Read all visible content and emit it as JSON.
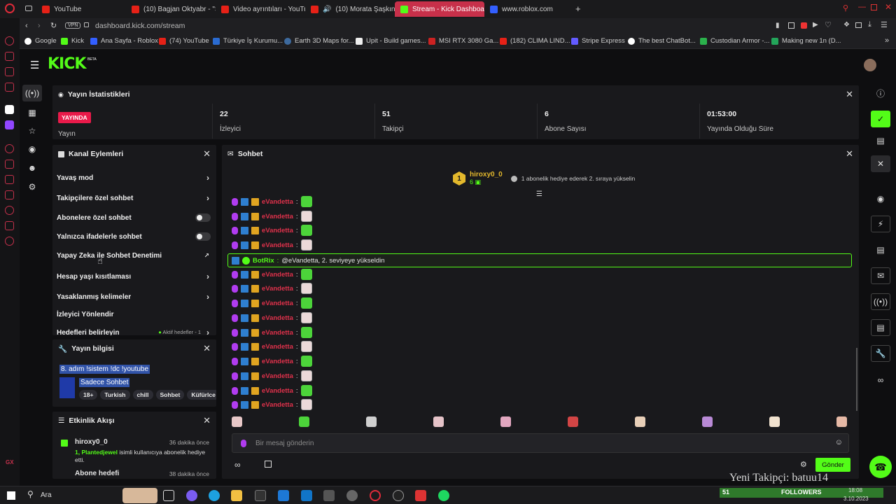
{
  "browser": {
    "tabs": [
      {
        "label": "YouTube",
        "color": "#e62117"
      },
      {
        "label": "(10) Bagjan Oktyabr - \"So",
        "color": "#e62117"
      },
      {
        "label": "Video ayrıntıları - YouTub",
        "color": "#e62117"
      },
      {
        "label": "(10) Morata Şaşkın #g",
        "color": "#e62117"
      },
      {
        "label": "Stream - Kick Dashboard",
        "color": "#53fc18"
      },
      {
        "label": "www.roblox.com",
        "color": "#335fff"
      }
    ],
    "address": "dashboard.kick.com/stream",
    "vpn_label": "VPN",
    "bookmarks": [
      "Google",
      "Kick",
      "Ana Sayfa - Roblox",
      "(74) YouTube",
      "Türkiye İş Kurumu...",
      "Earth 3D Maps for...",
      "Upit - Build games...",
      "MSI RTX 3080 Ga...",
      "(182) CLIMA LIND...",
      "Stripe Express",
      "The best ChatBot...",
      "Custodian Armor -...",
      "Making new 1n (D..."
    ]
  },
  "kick": {
    "logo": "KICK",
    "logo_sup": "BETA"
  },
  "stats": {
    "title": "Yayın İstatistikleri",
    "live_badge": "YAYINDA",
    "live_label": "Yayın",
    "items": [
      {
        "value": "22",
        "label": "İzleyici"
      },
      {
        "value": "51",
        "label": "Takipçi"
      },
      {
        "value": "6",
        "label": "Abone Sayısı"
      },
      {
        "value": "01:53:00",
        "label": "Yayında Olduğu Süre"
      }
    ]
  },
  "actions": {
    "title": "Kanal Eylemleri",
    "items": [
      "Yavaş mod",
      "Takipçilere özel sohbet",
      "Abonelere özel sohbet",
      "Yalnızca ifadelerle sohbet",
      "Yapay Zeka ile Sohbet Denetimi",
      "Hesap yaşı kısıtlaması",
      "Yasaklanmış kelimeler",
      "İzleyici Yönlendir",
      "Hedefleri belirleyin"
    ],
    "goals_hint": "Aktif hedefler - 1"
  },
  "streaminfo": {
    "title": "Yayın bilgisi",
    "stream_title": "8. adım !sistem !dc !youtube",
    "category": "Sadece Sohbet",
    "tags": [
      "18+",
      "Turkish",
      "chill",
      "Sohbet",
      "Küfürlce"
    ]
  },
  "activity": {
    "title": "Etkinlik Akışı",
    "items": [
      {
        "user": "hiroxy0_0",
        "time": "36 dakika önce",
        "desc_highlight": "1, Plantedjewel",
        "desc": " isimli kullanıcıya abonelik hediye etti."
      },
      {
        "user": "Abone hedefi",
        "time": "38 dakika önce"
      }
    ]
  },
  "chat": {
    "title": "Sohbet",
    "pinned_user": "hiroxy0_0",
    "pinned_count": "6",
    "pinned_rank": "1",
    "pinned_hint": "1 abonelik hediye ederek 2. sıraya yükselin",
    "username": "eVandetta",
    "bot_name": "BotRix",
    "bot_message": "@eVandetta, 2. seviyeye yükseldin",
    "input_placeholder": "Bir mesaj gönderin",
    "send_label": "Gönder"
  },
  "overlay": {
    "new_follower": "Yeni Takipçi: batuu14",
    "followers_count": "51",
    "followers_label": "FOLLOWERS"
  },
  "taskbar": {
    "search_label": "Ara",
    "time": "18:08",
    "date": "3.10.2023"
  },
  "colors": {
    "kick_green": "#53fc18",
    "live_red": "#e91a4a",
    "chat_user": "#e0314b"
  }
}
